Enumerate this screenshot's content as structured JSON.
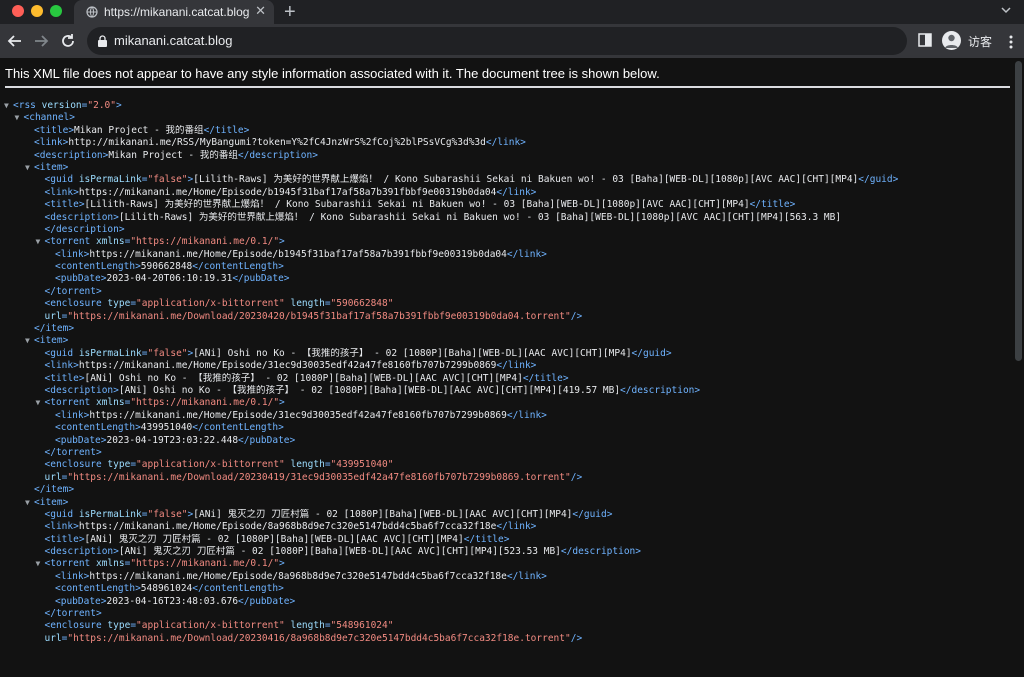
{
  "tab": {
    "title": "https://mikanani.catcat.blog",
    "close_label": "✕",
    "new_tab_label": "+"
  },
  "toolbar": {
    "url": "mikanani.catcat.blog",
    "profile_name": "访客"
  },
  "notice": "This XML file does not appear to have any style information associated with it. The document tree is shown below.",
  "colors": {
    "tag": "#6fb3ff",
    "attr_name": "#9cdcfe",
    "attr_value": "#f28b82",
    "text": "#e8eaed",
    "background": "#121212"
  },
  "xml_lines": [
    {
      "indent": 0,
      "toggle": "▼",
      "parts": [
        [
          "tag",
          "<rss"
        ],
        [
          "aname",
          " version"
        ],
        [
          "tag",
          "="
        ],
        [
          "aval",
          "\"2.0\""
        ],
        [
          "tag",
          ">"
        ]
      ]
    },
    {
      "indent": 1,
      "toggle": "▼",
      "parts": [
        [
          "tag",
          "<channel>"
        ]
      ]
    },
    {
      "indent": 2,
      "toggle": "",
      "parts": [
        [
          "tag",
          "<title>"
        ],
        [
          "txt",
          "Mikan Project - 我的番组"
        ],
        [
          "tag",
          "</title>"
        ]
      ]
    },
    {
      "indent": 2,
      "toggle": "",
      "parts": [
        [
          "tag",
          "<link>"
        ],
        [
          "txt",
          "http://mikanani.me/RSS/MyBangumi?token=Y%2fC4JnzWrS%2fCoj%2blPSsVCg%3d%3d"
        ],
        [
          "tag",
          "</link>"
        ]
      ]
    },
    {
      "indent": 2,
      "toggle": "",
      "parts": [
        [
          "tag",
          "<description>"
        ],
        [
          "txt",
          "Mikan Project - 我的番组"
        ],
        [
          "tag",
          "</description>"
        ]
      ]
    },
    {
      "indent": 2,
      "toggle": "▼",
      "parts": [
        [
          "tag",
          "<item>"
        ]
      ]
    },
    {
      "indent": 3,
      "toggle": "",
      "parts": [
        [
          "tag",
          "<guid"
        ],
        [
          "aname",
          " isPermaLink"
        ],
        [
          "tag",
          "="
        ],
        [
          "aval",
          "\"false\""
        ],
        [
          "tag",
          ">"
        ],
        [
          "txt",
          "[Lilith-Raws] 为美好的世界献上爆焰！ / Kono Subarashii Sekai ni Bakuen wo! - 03 [Baha][WEB-DL][1080p][AVC AAC][CHT][MP4]"
        ],
        [
          "tag",
          "</guid>"
        ]
      ]
    },
    {
      "indent": 3,
      "toggle": "",
      "parts": [
        [
          "tag",
          "<link>"
        ],
        [
          "txt",
          "https://mikanani.me/Home/Episode/b1945f31baf17af58a7b391fbbf9e00319b0da04"
        ],
        [
          "tag",
          "</link>"
        ]
      ]
    },
    {
      "indent": 3,
      "toggle": "",
      "parts": [
        [
          "tag",
          "<title>"
        ],
        [
          "txt",
          "[Lilith-Raws] 为美好的世界献上爆焰！ / Kono Subarashii Sekai ni Bakuen wo! - 03 [Baha][WEB-DL][1080p][AVC AAC][CHT][MP4]"
        ],
        [
          "tag",
          "</title>"
        ]
      ]
    },
    {
      "indent": 3,
      "toggle": "",
      "parts": [
        [
          "tag",
          "<description>"
        ],
        [
          "txt",
          "[Lilith-Raws] 为美好的世界献上爆焰！ / Kono Subarashii Sekai ni Bakuen wo! - 03 [Baha][WEB-DL][1080p][AVC AAC][CHT][MP4][563.3 MB]"
        ]
      ]
    },
    {
      "indent": 3,
      "toggle": "",
      "parts": [
        [
          "tag",
          "</description>"
        ]
      ]
    },
    {
      "indent": 3,
      "toggle": "▼",
      "parts": [
        [
          "tag",
          "<torrent"
        ],
        [
          "aname",
          " xmlns"
        ],
        [
          "tag",
          "="
        ],
        [
          "aval",
          "\"https://mikanani.me/0.1/\""
        ],
        [
          "tag",
          ">"
        ]
      ]
    },
    {
      "indent": 4,
      "toggle": "",
      "parts": [
        [
          "tag",
          "<link>"
        ],
        [
          "txt",
          "https://mikanani.me/Home/Episode/b1945f31baf17af58a7b391fbbf9e00319b0da04"
        ],
        [
          "tag",
          "</link>"
        ]
      ]
    },
    {
      "indent": 4,
      "toggle": "",
      "parts": [
        [
          "tag",
          "<contentLength>"
        ],
        [
          "txt",
          "590662848"
        ],
        [
          "tag",
          "</contentLength>"
        ]
      ]
    },
    {
      "indent": 4,
      "toggle": "",
      "parts": [
        [
          "tag",
          "<pubDate>"
        ],
        [
          "txt",
          "2023-04-20T06:10:19.31"
        ],
        [
          "tag",
          "</pubDate>"
        ]
      ]
    },
    {
      "indent": 3,
      "toggle": "",
      "parts": [
        [
          "tag",
          "</torrent>"
        ]
      ]
    },
    {
      "indent": 3,
      "toggle": "",
      "parts": [
        [
          "tag",
          "<enclosure"
        ],
        [
          "aname",
          " type"
        ],
        [
          "tag",
          "="
        ],
        [
          "aval",
          "\"application/x-bittorrent\""
        ],
        [
          "aname",
          " length"
        ],
        [
          "tag",
          "="
        ],
        [
          "aval",
          "\"590662848\""
        ]
      ]
    },
    {
      "indent": 3,
      "toggle": "",
      "parts": [
        [
          "aname",
          "url"
        ],
        [
          "tag",
          "="
        ],
        [
          "aval",
          "\"https://mikanani.me/Download/20230420/b1945f31baf17af58a7b391fbbf9e00319b0da04.torrent\""
        ],
        [
          "tag",
          "/>"
        ]
      ]
    },
    {
      "indent": 2,
      "toggle": "",
      "parts": [
        [
          "tag",
          "</item>"
        ]
      ]
    },
    {
      "indent": 2,
      "toggle": "▼",
      "parts": [
        [
          "tag",
          "<item>"
        ]
      ]
    },
    {
      "indent": 3,
      "toggle": "",
      "parts": [
        [
          "tag",
          "<guid"
        ],
        [
          "aname",
          " isPermaLink"
        ],
        [
          "tag",
          "="
        ],
        [
          "aval",
          "\"false\""
        ],
        [
          "tag",
          ">"
        ],
        [
          "txt",
          "[ANi] Oshi no Ko - 【我推的孩子】 - 02 [1080P][Baha][WEB-DL][AAC AVC][CHT][MP4]"
        ],
        [
          "tag",
          "</guid>"
        ]
      ]
    },
    {
      "indent": 3,
      "toggle": "",
      "parts": [
        [
          "tag",
          "<link>"
        ],
        [
          "txt",
          "https://mikanani.me/Home/Episode/31ec9d30035edf42a47fe8160fb707b7299b0869"
        ],
        [
          "tag",
          "</link>"
        ]
      ]
    },
    {
      "indent": 3,
      "toggle": "",
      "parts": [
        [
          "tag",
          "<title>"
        ],
        [
          "txt",
          "[ANi] Oshi no Ko - 【我推的孩子】 - 02 [1080P][Baha][WEB-DL][AAC AVC][CHT][MP4]"
        ],
        [
          "tag",
          "</title>"
        ]
      ]
    },
    {
      "indent": 3,
      "toggle": "",
      "parts": [
        [
          "tag",
          "<description>"
        ],
        [
          "txt",
          "[ANi] Oshi no Ko - 【我推的孩子】 - 02 [1080P][Baha][WEB-DL][AAC AVC][CHT][MP4][419.57 MB]"
        ],
        [
          "tag",
          "</description>"
        ]
      ]
    },
    {
      "indent": 3,
      "toggle": "▼",
      "parts": [
        [
          "tag",
          "<torrent"
        ],
        [
          "aname",
          " xmlns"
        ],
        [
          "tag",
          "="
        ],
        [
          "aval",
          "\"https://mikanani.me/0.1/\""
        ],
        [
          "tag",
          ">"
        ]
      ]
    },
    {
      "indent": 4,
      "toggle": "",
      "parts": [
        [
          "tag",
          "<link>"
        ],
        [
          "txt",
          "https://mikanani.me/Home/Episode/31ec9d30035edf42a47fe8160fb707b7299b0869"
        ],
        [
          "tag",
          "</link>"
        ]
      ]
    },
    {
      "indent": 4,
      "toggle": "",
      "parts": [
        [
          "tag",
          "<contentLength>"
        ],
        [
          "txt",
          "439951040"
        ],
        [
          "tag",
          "</contentLength>"
        ]
      ]
    },
    {
      "indent": 4,
      "toggle": "",
      "parts": [
        [
          "tag",
          "<pubDate>"
        ],
        [
          "txt",
          "2023-04-19T23:03:22.448"
        ],
        [
          "tag",
          "</pubDate>"
        ]
      ]
    },
    {
      "indent": 3,
      "toggle": "",
      "parts": [
        [
          "tag",
          "</torrent>"
        ]
      ]
    },
    {
      "indent": 3,
      "toggle": "",
      "parts": [
        [
          "tag",
          "<enclosure"
        ],
        [
          "aname",
          " type"
        ],
        [
          "tag",
          "="
        ],
        [
          "aval",
          "\"application/x-bittorrent\""
        ],
        [
          "aname",
          " length"
        ],
        [
          "tag",
          "="
        ],
        [
          "aval",
          "\"439951040\""
        ]
      ]
    },
    {
      "indent": 3,
      "toggle": "",
      "parts": [
        [
          "aname",
          "url"
        ],
        [
          "tag",
          "="
        ],
        [
          "aval",
          "\"https://mikanani.me/Download/20230419/31ec9d30035edf42a47fe8160fb707b7299b0869.torrent\""
        ],
        [
          "tag",
          "/>"
        ]
      ]
    },
    {
      "indent": 2,
      "toggle": "",
      "parts": [
        [
          "tag",
          "</item>"
        ]
      ]
    },
    {
      "indent": 2,
      "toggle": "▼",
      "parts": [
        [
          "tag",
          "<item>"
        ]
      ]
    },
    {
      "indent": 3,
      "toggle": "",
      "parts": [
        [
          "tag",
          "<guid"
        ],
        [
          "aname",
          " isPermaLink"
        ],
        [
          "tag",
          "="
        ],
        [
          "aval",
          "\"false\""
        ],
        [
          "tag",
          ">"
        ],
        [
          "txt",
          "[ANi] 鬼灭之刃 刀匠村篇 - 02 [1080P][Baha][WEB-DL][AAC AVC][CHT][MP4]"
        ],
        [
          "tag",
          "</guid>"
        ]
      ]
    },
    {
      "indent": 3,
      "toggle": "",
      "parts": [
        [
          "tag",
          "<link>"
        ],
        [
          "txt",
          "https://mikanani.me/Home/Episode/8a968b8d9e7c320e5147bdd4c5ba6f7cca32f18e"
        ],
        [
          "tag",
          "</link>"
        ]
      ]
    },
    {
      "indent": 3,
      "toggle": "",
      "parts": [
        [
          "tag",
          "<title>"
        ],
        [
          "txt",
          "[ANi] 鬼灭之刃 刀匠村篇 - 02 [1080P][Baha][WEB-DL][AAC AVC][CHT][MP4]"
        ],
        [
          "tag",
          "</title>"
        ]
      ]
    },
    {
      "indent": 3,
      "toggle": "",
      "parts": [
        [
          "tag",
          "<description>"
        ],
        [
          "txt",
          "[ANi] 鬼灭之刃 刀匠村篇 - 02 [1080P][Baha][WEB-DL][AAC AVC][CHT][MP4][523.53 MB]"
        ],
        [
          "tag",
          "</description>"
        ]
      ]
    },
    {
      "indent": 3,
      "toggle": "▼",
      "parts": [
        [
          "tag",
          "<torrent"
        ],
        [
          "aname",
          " xmlns"
        ],
        [
          "tag",
          "="
        ],
        [
          "aval",
          "\"https://mikanani.me/0.1/\""
        ],
        [
          "tag",
          ">"
        ]
      ]
    },
    {
      "indent": 4,
      "toggle": "",
      "parts": [
        [
          "tag",
          "<link>"
        ],
        [
          "txt",
          "https://mikanani.me/Home/Episode/8a968b8d9e7c320e5147bdd4c5ba6f7cca32f18e"
        ],
        [
          "tag",
          "</link>"
        ]
      ]
    },
    {
      "indent": 4,
      "toggle": "",
      "parts": [
        [
          "tag",
          "<contentLength>"
        ],
        [
          "txt",
          "548961024"
        ],
        [
          "tag",
          "</contentLength>"
        ]
      ]
    },
    {
      "indent": 4,
      "toggle": "",
      "parts": [
        [
          "tag",
          "<pubDate>"
        ],
        [
          "txt",
          "2023-04-16T23:48:03.676"
        ],
        [
          "tag",
          "</pubDate>"
        ]
      ]
    },
    {
      "indent": 3,
      "toggle": "",
      "parts": [
        [
          "tag",
          "</torrent>"
        ]
      ]
    },
    {
      "indent": 3,
      "toggle": "",
      "parts": [
        [
          "tag",
          "<enclosure"
        ],
        [
          "aname",
          " type"
        ],
        [
          "tag",
          "="
        ],
        [
          "aval",
          "\"application/x-bittorrent\""
        ],
        [
          "aname",
          " length"
        ],
        [
          "tag",
          "="
        ],
        [
          "aval",
          "\"548961024\""
        ]
      ]
    },
    {
      "indent": 3,
      "toggle": "",
      "parts": [
        [
          "aname",
          "url"
        ],
        [
          "tag",
          "="
        ],
        [
          "aval",
          "\"https://mikanani.me/Download/20230416/8a968b8d9e7c320e5147bdd4c5ba6f7cca32f18e.torrent\""
        ],
        [
          "tag",
          "/>"
        ]
      ]
    }
  ]
}
